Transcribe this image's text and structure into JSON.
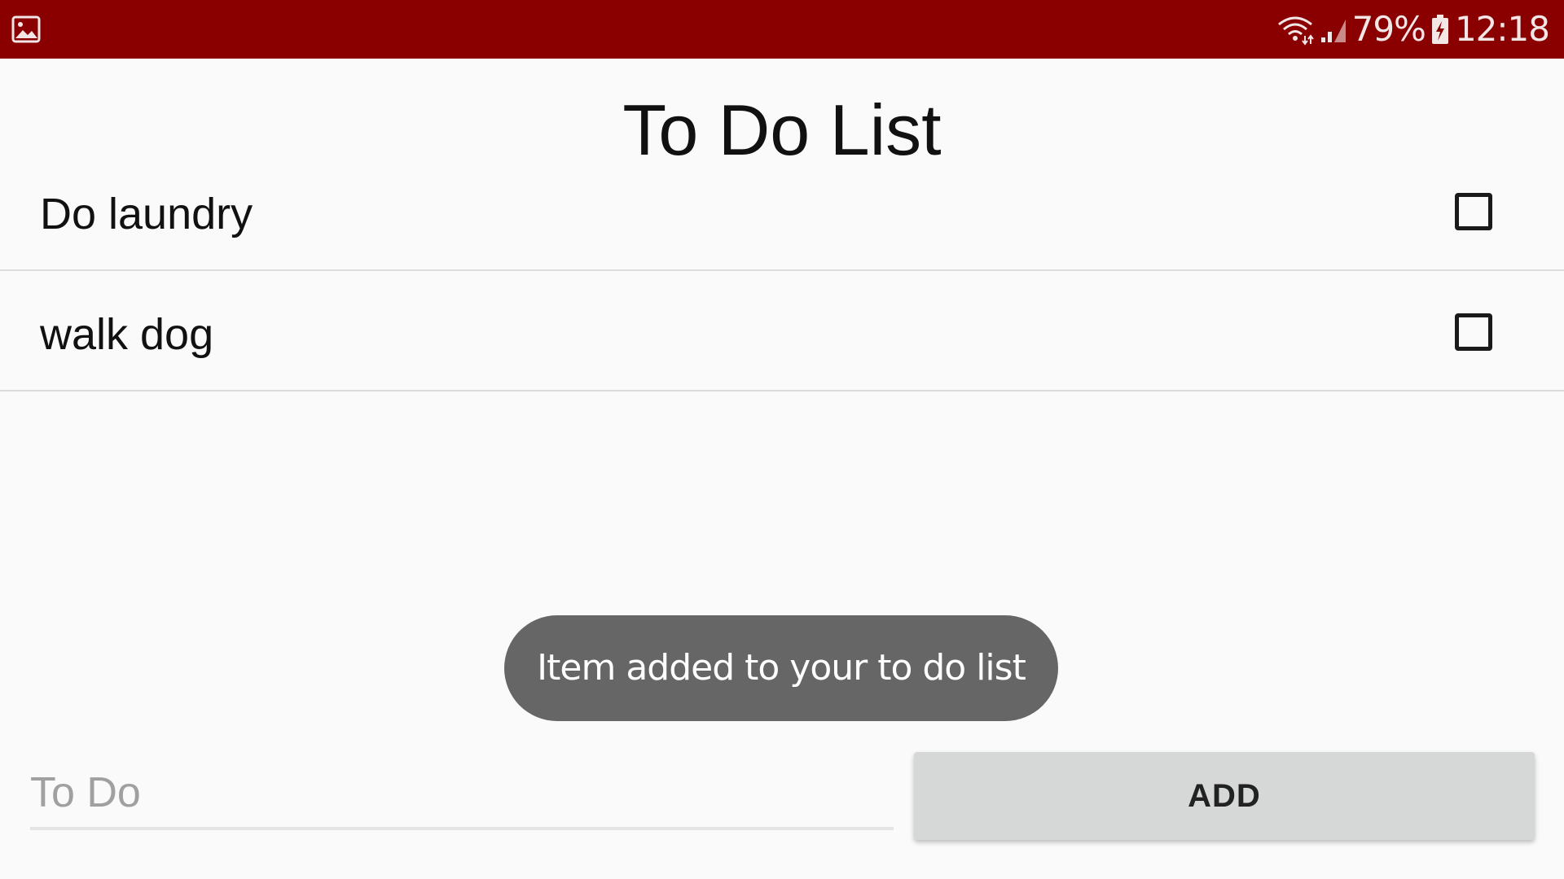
{
  "status_bar": {
    "battery_text": "79%",
    "time": "12:18",
    "background_color": "#8a0000",
    "icons": [
      "gallery-icon",
      "wifi-icon",
      "signal-icon",
      "battery-charging-icon"
    ]
  },
  "page": {
    "title": "To Do List"
  },
  "todo_items": [
    {
      "label": "Do laundry",
      "checked": false
    },
    {
      "label": "walk dog",
      "checked": false
    }
  ],
  "toast": {
    "message": "Item added to your to do list"
  },
  "input": {
    "placeholder": "To Do",
    "value": ""
  },
  "add_button": {
    "label": "ADD"
  }
}
